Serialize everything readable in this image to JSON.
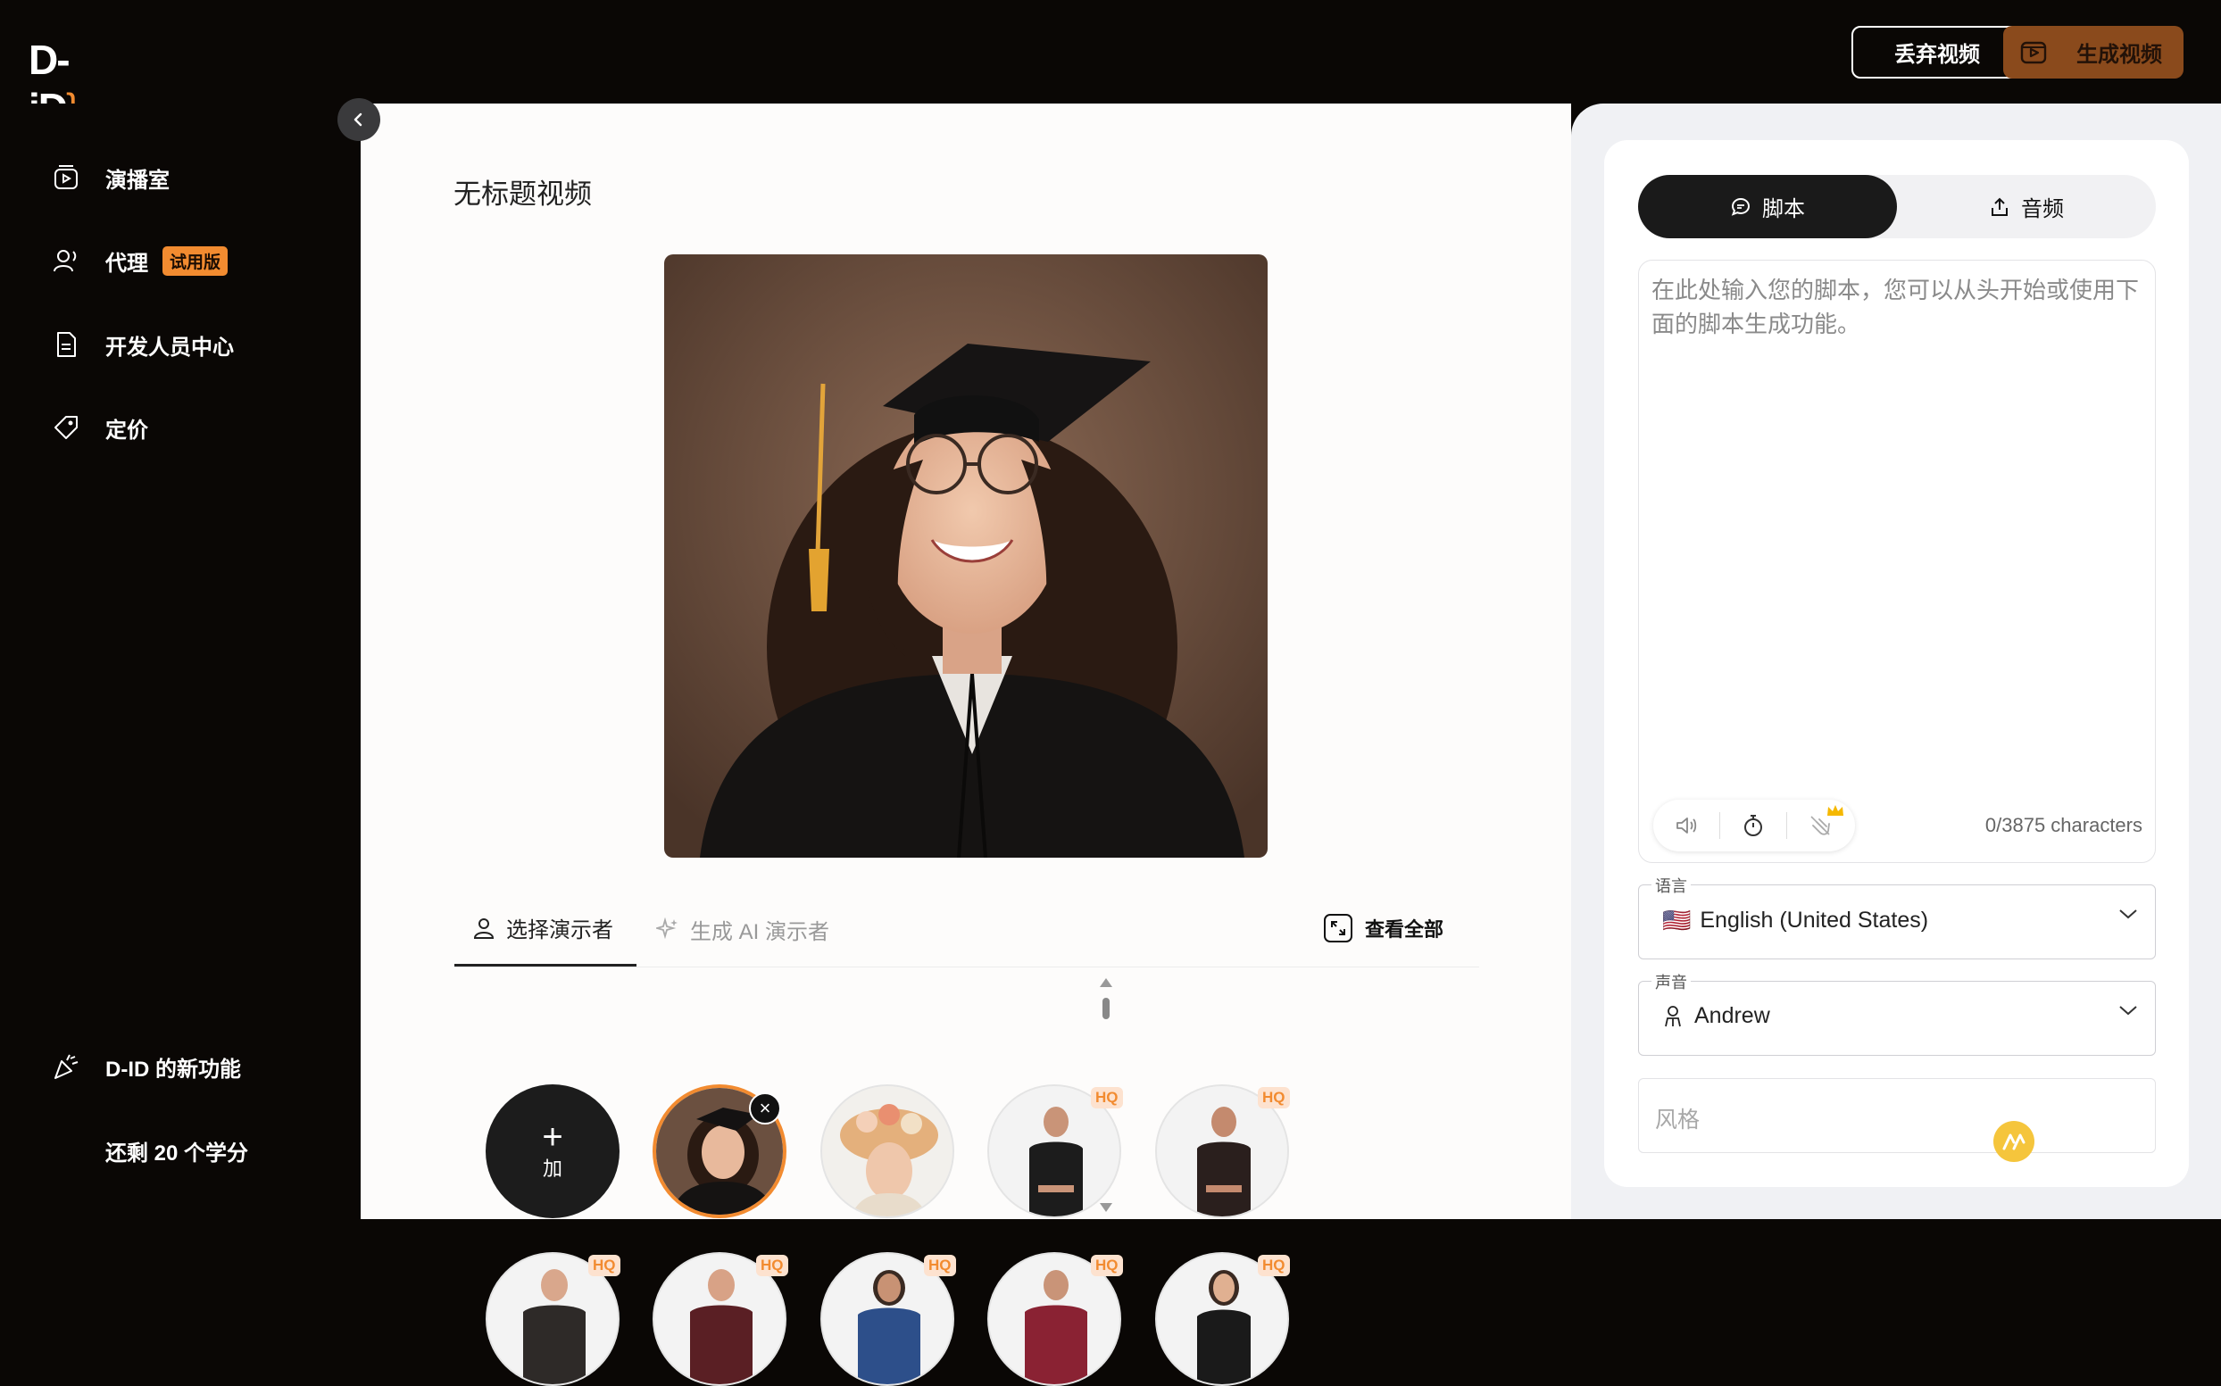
{
  "brand": {
    "logo_text": "D-iD"
  },
  "topbar": {
    "discard_label": "丢弃视频",
    "generate_label": "生成视频"
  },
  "sidebar": {
    "items": [
      {
        "label": "演播室",
        "icon": "studio-icon"
      },
      {
        "label": "代理",
        "icon": "agents-icon",
        "badge": "试用版"
      },
      {
        "label": "开发人员中心",
        "icon": "document-icon"
      },
      {
        "label": "定价",
        "icon": "price-tag-icon"
      }
    ],
    "whats_new": "D-ID 的新功能",
    "credits": "还剩 20 个学分"
  },
  "main": {
    "title": "无标题视频",
    "presenter_tabs": {
      "select_label": "选择演示者",
      "generate_label": "生成 AI 演示者",
      "view_all_label": "查看全部"
    },
    "add_label": "加",
    "hq_badge": "HQ"
  },
  "right": {
    "tab_script": "脚本",
    "tab_audio": "音频",
    "script_placeholder": "在此处输入您的脚本，您可以从头开始或使用下面的脚本生成功能。",
    "char_count": "0/3875 characters",
    "language_label": "语言",
    "language_value": "English (United States)",
    "language_flag": "🇺🇸",
    "voice_label": "声音",
    "voice_value": "Andrew",
    "style_placeholder": "风格"
  },
  "colors": {
    "accent": "#f28b30",
    "dark_bg": "#0a0705",
    "generate_button": "#8a4a1c"
  }
}
